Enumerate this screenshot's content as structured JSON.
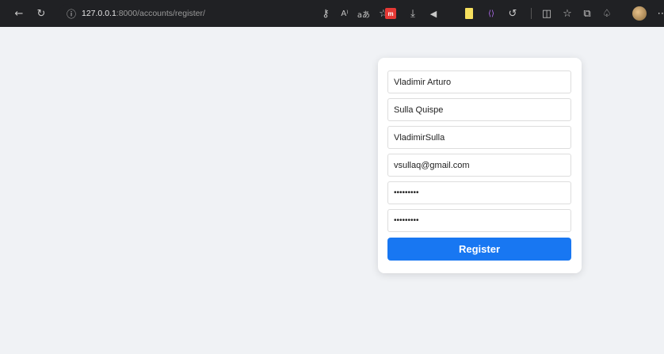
{
  "browser": {
    "url_host": "127.0.0.1",
    "url_path": ":8000/accounts/register/",
    "icons": [
      "back-arrow-icon",
      "reload-icon",
      "site-info-icon",
      "key-icon",
      "read-aloud-icon",
      "translate-icon",
      "favorite-star-icon",
      "ext-red-icon",
      "download-icon",
      "volume-icon",
      "ext-yellow-icon",
      "ext-code-icon",
      "copilot-icon",
      "split-screen-icon",
      "favorites-list-icon",
      "collections-icon",
      "extensions-icon",
      "profile-avatar-icon",
      "more-icon"
    ]
  },
  "form": {
    "first_name": "Vladimir Arturo",
    "last_name": "Sulla Quispe",
    "username": "VladimirSulla",
    "email": "vsullaq@gmail.com",
    "password1": "•••••••••",
    "password2": "•••••••••",
    "register_label": "Register"
  }
}
